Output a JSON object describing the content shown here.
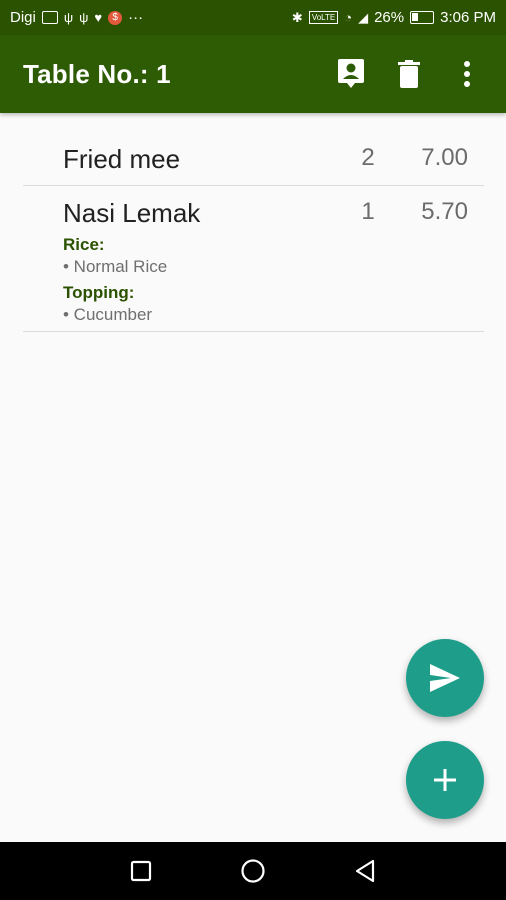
{
  "status_bar": {
    "carrier": "Digi",
    "more": "···",
    "network_badge": "VoLTE",
    "battery": "26%",
    "time": "3:06 PM",
    "icons": [
      "usb-icon",
      "usb-icon",
      "heart-icon",
      "notification-icon",
      "bluetooth-icon",
      "wifi-icon",
      "signal-icon",
      "battery-icon"
    ]
  },
  "app_bar": {
    "title": "Table No.: 1",
    "actions": [
      "contact-icon",
      "delete-icon",
      "more-vert-icon"
    ]
  },
  "order": {
    "items": [
      {
        "name": "Fried mee",
        "qty": "2",
        "price": "7.00",
        "options": []
      },
      {
        "name": "Nasi Lemak",
        "qty": "1",
        "price": "5.70",
        "options": [
          {
            "label": "Rice:",
            "value": "• Normal Rice"
          },
          {
            "label": "Topping:",
            "value": "• Cucumber"
          }
        ]
      }
    ]
  },
  "fabs": {
    "send": "send-icon",
    "add": "add-icon"
  },
  "nav_bar": [
    "back-icon",
    "home-icon",
    "recents-icon"
  ],
  "colors": {
    "primary": "#2e5c05",
    "accent": "#1e9e8a",
    "option_label": "#2b5200"
  }
}
